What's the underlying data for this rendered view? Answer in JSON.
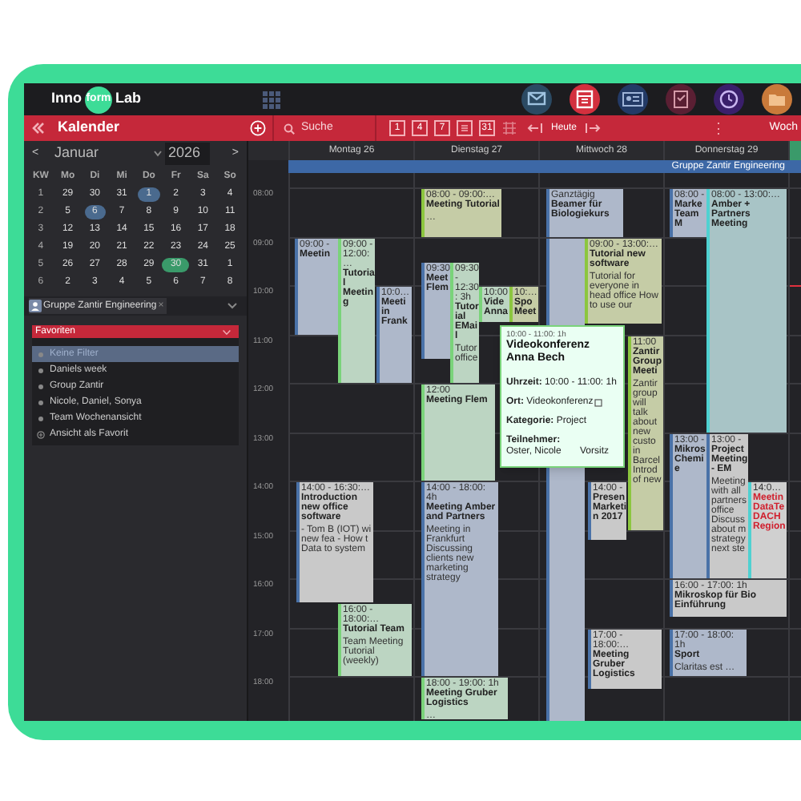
{
  "logo": {
    "left": "Inno",
    "middle": "form",
    "right": "Lab"
  },
  "apps": [
    {
      "kind": "mail"
    },
    {
      "kind": "calendar"
    },
    {
      "kind": "contacts"
    },
    {
      "kind": "tasks"
    },
    {
      "kind": "clock"
    },
    {
      "kind": "folder"
    }
  ],
  "toolbar": {
    "title": "Kalender",
    "search_placeholder": "Suche",
    "views": [
      {
        "kind": "number",
        "label": "1"
      },
      {
        "kind": "number",
        "label": "4"
      },
      {
        "kind": "number",
        "label": "7"
      },
      {
        "kind": "list"
      },
      {
        "kind": "number",
        "label": "31"
      },
      {
        "kind": "grid"
      }
    ],
    "today": "Heute",
    "more": "⋮",
    "view": "Woch"
  },
  "mini_calendar": {
    "prev": "<",
    "month": "Januar",
    "year": "2026",
    "next": ">",
    "headers": [
      "KW",
      "Mo",
      "Di",
      "Mi",
      "Do",
      "Fr",
      "Sa",
      "So"
    ],
    "weeks": [
      {
        "kw": "1",
        "days": [
          {
            "label": "29",
            "kind": "plain"
          },
          {
            "label": "30",
            "kind": "plain"
          },
          {
            "label": "31",
            "kind": "plain"
          },
          {
            "label": "1",
            "kind": "marked"
          },
          {
            "label": "2",
            "kind": "plain"
          },
          {
            "label": "3",
            "kind": "plain"
          },
          {
            "label": "4",
            "kind": "plain"
          }
        ]
      },
      {
        "kw": "2",
        "days": [
          {
            "label": "5",
            "kind": "plain"
          },
          {
            "label": "6",
            "kind": "marked"
          },
          {
            "label": "7",
            "kind": "plain"
          },
          {
            "label": "8",
            "kind": "plain"
          },
          {
            "label": "9",
            "kind": "plain"
          },
          {
            "label": "10",
            "kind": "plain"
          },
          {
            "label": "11",
            "kind": "plain"
          }
        ]
      },
      {
        "kw": "3",
        "days": [
          {
            "label": "12",
            "kind": "plain"
          },
          {
            "label": "13",
            "kind": "plain"
          },
          {
            "label": "14",
            "kind": "plain"
          },
          {
            "label": "15",
            "kind": "plain"
          },
          {
            "label": "16",
            "kind": "plain"
          },
          {
            "label": "17",
            "kind": "plain"
          },
          {
            "label": "18",
            "kind": "plain"
          }
        ]
      },
      {
        "kw": "4",
        "days": [
          {
            "label": "19",
            "kind": "plain"
          },
          {
            "label": "20",
            "kind": "plain"
          },
          {
            "label": "21",
            "kind": "plain"
          },
          {
            "label": "22",
            "kind": "plain"
          },
          {
            "label": "23",
            "kind": "plain"
          },
          {
            "label": "24",
            "kind": "plain"
          },
          {
            "label": "25",
            "kind": "plain"
          }
        ]
      },
      {
        "kw": "5",
        "days": [
          {
            "label": "26",
            "kind": "plain"
          },
          {
            "label": "27",
            "kind": "plain"
          },
          {
            "label": "28",
            "kind": "plain"
          },
          {
            "label": "29",
            "kind": "plain"
          },
          {
            "label": "30",
            "kind": "today"
          },
          {
            "label": "31",
            "kind": "plain"
          },
          {
            "label": "1",
            "kind": "plain"
          }
        ]
      },
      {
        "kw": "6",
        "days": [
          {
            "label": "2",
            "kind": "plain"
          },
          {
            "label": "3",
            "kind": "plain"
          },
          {
            "label": "4",
            "kind": "plain"
          },
          {
            "label": "5",
            "kind": "plain"
          },
          {
            "label": "6",
            "kind": "plain"
          },
          {
            "label": "7",
            "kind": "plain"
          },
          {
            "label": "8",
            "kind": "plain"
          }
        ]
      }
    ]
  },
  "group_filter": {
    "label": "Gruppe Zantir Engineering",
    "remove": "×"
  },
  "favorites": {
    "title": "Favoriten",
    "items": [
      {
        "label": "Keine Filter",
        "kind": "filter",
        "selected": true
      },
      {
        "label": "Daniels week",
        "kind": "filter",
        "selected": false
      },
      {
        "label": "Group Zantir",
        "kind": "filter",
        "selected": false
      },
      {
        "label": "Nicole, Daniel, Sonya",
        "kind": "filter",
        "selected": false
      },
      {
        "label": "Team Wochenansicht",
        "kind": "filter",
        "selected": false
      },
      {
        "label": "Ansicht als Favorit",
        "kind": "action",
        "selected": false
      }
    ]
  },
  "times": [
    "08:00",
    "09:00",
    "10:00",
    "11:00",
    "12:00",
    "13:00",
    "14:00",
    "15:00",
    "16:00",
    "17:00",
    "18:00"
  ],
  "all_day": "Gruppe Zantir Engineering",
  "days": [
    {
      "label": "Montag 26",
      "today": false,
      "events": [
        {
          "time": "09:00 -",
          "title": "Meetin",
          "kind": "blue"
        },
        {
          "time": "09:00 - 12:00:…",
          "title": "Tutorial Meeting",
          "kind": "green"
        },
        {
          "time": "10:0…",
          "title": "Meeti in Frank",
          "kind": "blue"
        },
        {
          "time": "14:00 - 16:30:…",
          "title": "Introduction new office software",
          "notes": "- Tom B (IOT) wi new fea - How t Data to system",
          "kind": "gray"
        },
        {
          "time": "16:00 - 18:00:…",
          "title": "Tutorial Team",
          "notes": "Team Meeting Tutorial (weekly)",
          "kind": "green"
        }
      ]
    },
    {
      "label": "Dienstag 27",
      "today": false,
      "events": [
        {
          "time": "08:00 - 09:00:…",
          "title": "Meeting Tutorial",
          "notes": "…",
          "kind": "olive"
        },
        {
          "time": "09:30",
          "title": "Meet Flem",
          "kind": "blue"
        },
        {
          "time": "09:30 - 12:30: 3h",
          "title": "Tutorial EMail",
          "notes": "Tutor office",
          "kind": "green"
        },
        {
          "time": "10:00",
          "title": "Vide Anna",
          "kind": "green"
        },
        {
          "time": "10:…",
          "title": "Spo Meet",
          "kind": "olive"
        },
        {
          "time": "12:00",
          "title": "Meeting Flem",
          "kind": "green"
        },
        {
          "time": "14:00 - 18:00: 4h",
          "title": "Meeting Amber and Partners",
          "notes": "Meeting in Frankfurt Discussing clients new marketing strategy",
          "kind": "blue"
        },
        {
          "time": "18:00 - 19:00: 1h",
          "title": "Meeting Gruber Logistics",
          "notes": "…",
          "kind": "green"
        }
      ]
    },
    {
      "label": "Mittwoch 28",
      "today": false,
      "events": [
        {
          "time": "Ganztägig",
          "title": "Beamer für Biologiekurs",
          "kind": "blue"
        },
        {
          "time": "09:00 - 13:00:…",
          "title": "Tutorial new software",
          "notes": "Tutorial for everyone in head office How to use our",
          "kind": "olive"
        },
        {
          "time": "11:00",
          "title": "Zantir Group Meeti",
          "notes": "Zantir group will talk about new custo in Barcel Introd of new",
          "kind": "olive"
        },
        {
          "time": "14:00 -",
          "title": "Presen Marketin 2017",
          "kind": "gray"
        },
        {
          "time": "17:00 - 18:00:…",
          "title": "Meeting Gruber Logistics",
          "kind": "gray"
        }
      ]
    },
    {
      "label": "Donnerstag 29",
      "today": false,
      "events": [
        {
          "time": "08:00 -",
          "title": "Marke Team M",
          "kind": "blue"
        },
        {
          "time": "08:00 - 13:00:…",
          "title": "Amber + Partners Meeting",
          "kind": "teal"
        },
        {
          "time": "13:00 -",
          "title": "Mikros Chemie",
          "kind": "blue"
        },
        {
          "time": "13:00 -",
          "title": "Project Meeting - EM",
          "notes": "Meeting with all partners office Discuss about m strategy next ste",
          "kind": "gray"
        },
        {
          "time": "14:0…",
          "title": "Meetin DataTe DACH Region",
          "kind": "alert"
        },
        {
          "time": "16:00 - 17:00: 1h",
          "title": "Mikroskop für Bio Einführung",
          "kind": "gray"
        },
        {
          "time": "17:00 - 18:00: 1h",
          "title": "Sport",
          "notes": "Claritas est …",
          "kind": "blue"
        }
      ]
    },
    {
      "today": true
    }
  ],
  "popup": {
    "time": "10:00 - 11:00: 1h",
    "title": "Videokonferenz Anna Bech",
    "fields": [
      "**Uhrzeit:** 10:00 - 11:00: 1h",
      "**Ort:** Videokonferenz",
      "**Kategorie:** Project"
    ],
    "participants_label": "Teilnehmer:",
    "participant": "Oster, Nicole",
    "role": "Vorsitz"
  }
}
